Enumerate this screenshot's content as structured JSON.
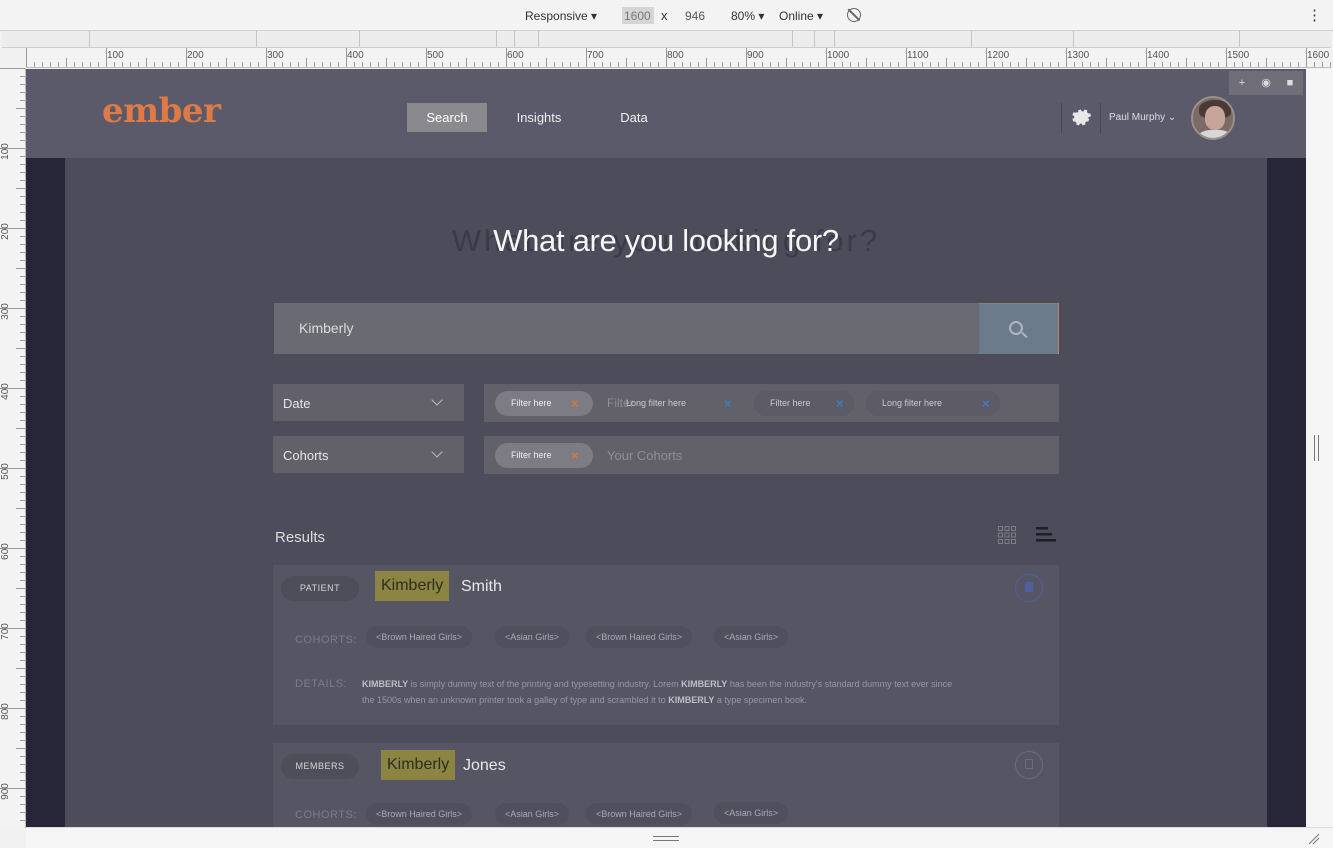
{
  "devtools": {
    "device": "Responsive ▾",
    "width": "1600",
    "times": "x",
    "height": "946",
    "zoom": "80% ▾",
    "network": "Online ▾",
    "more": "⋮"
  },
  "ruler_h": [
    "100",
    "200",
    "300",
    "400",
    "500",
    "600",
    "700",
    "800",
    "900",
    "1000",
    "1100",
    "1200",
    "1300",
    "1400",
    "1500",
    "1600"
  ],
  "ruler_v": [
    "100",
    "200",
    "300",
    "400",
    "500",
    "600",
    "700",
    "800",
    "900"
  ],
  "app": {
    "logo": "ember",
    "nav": [
      {
        "label": "Search",
        "active": true
      },
      {
        "label": "Insights",
        "active": false
      },
      {
        "label": "Data",
        "active": false
      }
    ],
    "user_name": "Paul Murphy",
    "hero_title": "What are you looking for?",
    "search_value": "Kimberly",
    "date_label": "Date",
    "cohorts_label": "Cohorts",
    "date_filters": [
      {
        "label": "Filter here",
        "x": "×",
        "style": "light"
      },
      {
        "label": "Long filter here",
        "x": "×",
        "style": "dark"
      },
      {
        "label": "Filter here",
        "x": "×",
        "style": "dark"
      },
      {
        "label": "Long filter here",
        "x": "×",
        "style": "dark"
      }
    ],
    "date_placeholder": "Filter",
    "cohort_filter": {
      "label": "Filter here",
      "x": "×"
    },
    "cohort_placeholder": "Your Cohorts",
    "results_title": "Results",
    "results": [
      {
        "type": "PATIENT",
        "first": "Kimberly",
        "last": "Smith",
        "cohorts_label": "COHORTS:",
        "tags": [
          "<Brown Haired Girls>",
          "<Asian Girls>",
          "<Brown Haired Girls>",
          "<Asian Girls>"
        ],
        "details_label": "DETAILS:",
        "details_line1_a": "KIMBERLY",
        "details_line1_b": " is simply dummy text of the printing and typesetting industry. Lorem ",
        "details_line1_c": "KIMBERLY",
        "details_line1_d": " has been the industry's standard dummy text ever since",
        "details_line2_a": "the 1500s when an unknown printer took a galley of type and scrambled it to ",
        "details_line2_b": "KIMBERLY",
        "details_line2_c": " a type specimen book."
      },
      {
        "type": "MEMBERS",
        "first": "Kimberly",
        "last": "Jones",
        "cohorts_label": "COHORTS:",
        "tags": [
          "<Brown Haired Girls>",
          "<Asian Girls>",
          "<Brown Haired Girls>",
          "<Asian Girls>"
        ]
      }
    ]
  },
  "pinbar": [
    "+",
    "◉",
    "■"
  ]
}
